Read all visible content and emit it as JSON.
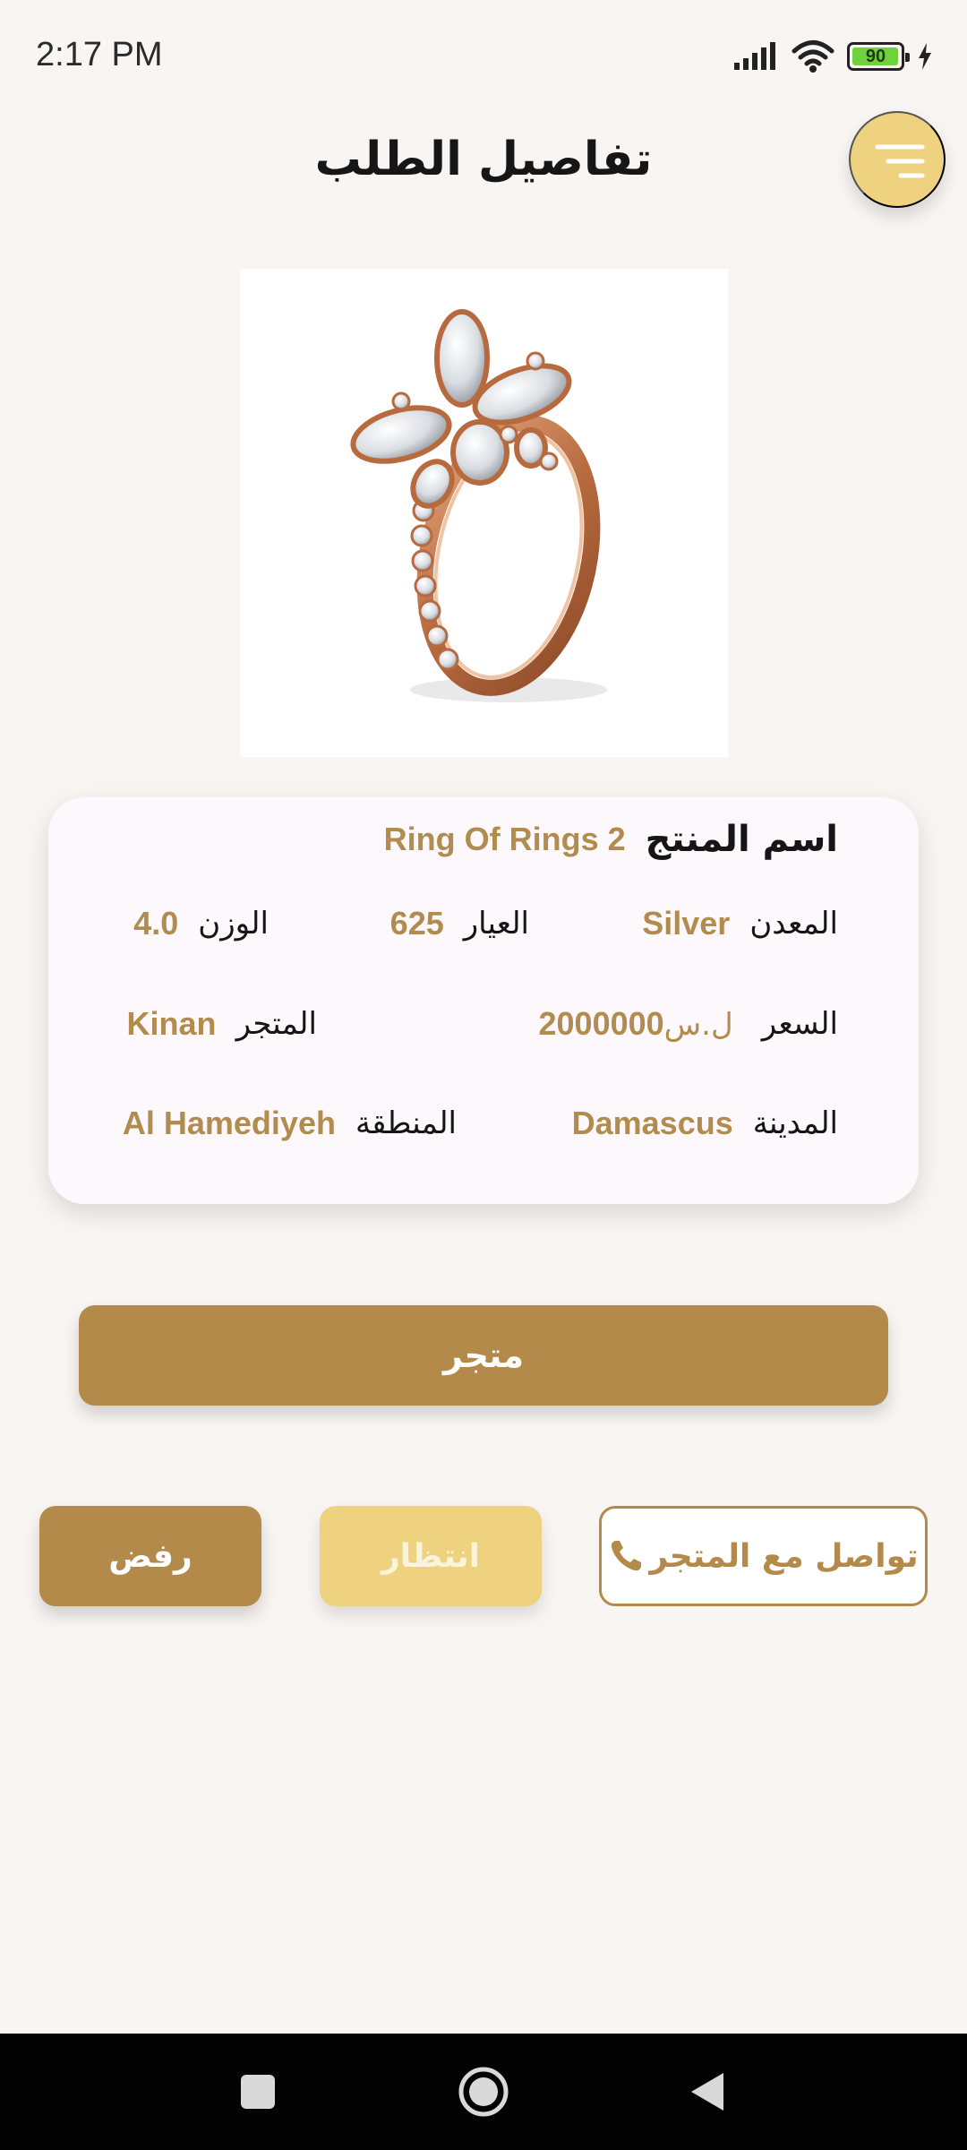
{
  "status_bar": {
    "time": "2:17 PM",
    "battery_level": "90"
  },
  "header": {
    "title": "تفاصيل الطلب"
  },
  "details": {
    "product_name_label": "اسم المنتج",
    "product_name_value": "Ring Of Rings 2",
    "metal_label": "المعدن",
    "metal_value": "Silver",
    "karat_label": "العيار",
    "karat_value": "625",
    "weight_label": "الوزن",
    "weight_value": "4.0",
    "price_label": "السعر",
    "price_value": "2000000",
    "price_currency": "ل.س",
    "store_label": "المتجر",
    "store_value": "Kinan",
    "city_label": "المدينة",
    "city_value": "Damascus",
    "region_label": "المنطقة",
    "region_value": "Al Hamediyeh"
  },
  "actions": {
    "store_button": "متجر",
    "reject_button": "رفض",
    "wait_button": "انتظار",
    "contact_button": "تواصل مع المتجر"
  },
  "colors": {
    "accent_gold": "#b48a4a",
    "light_gold": "#eed27f",
    "background": "#f9f5f3",
    "card": "#fcf8fb"
  },
  "icons": [
    "signal-icon",
    "wifi-icon",
    "battery-icon",
    "charging-icon",
    "menu-icon",
    "phone-icon",
    "nav-recents-icon",
    "nav-home-icon",
    "nav-back-icon"
  ]
}
